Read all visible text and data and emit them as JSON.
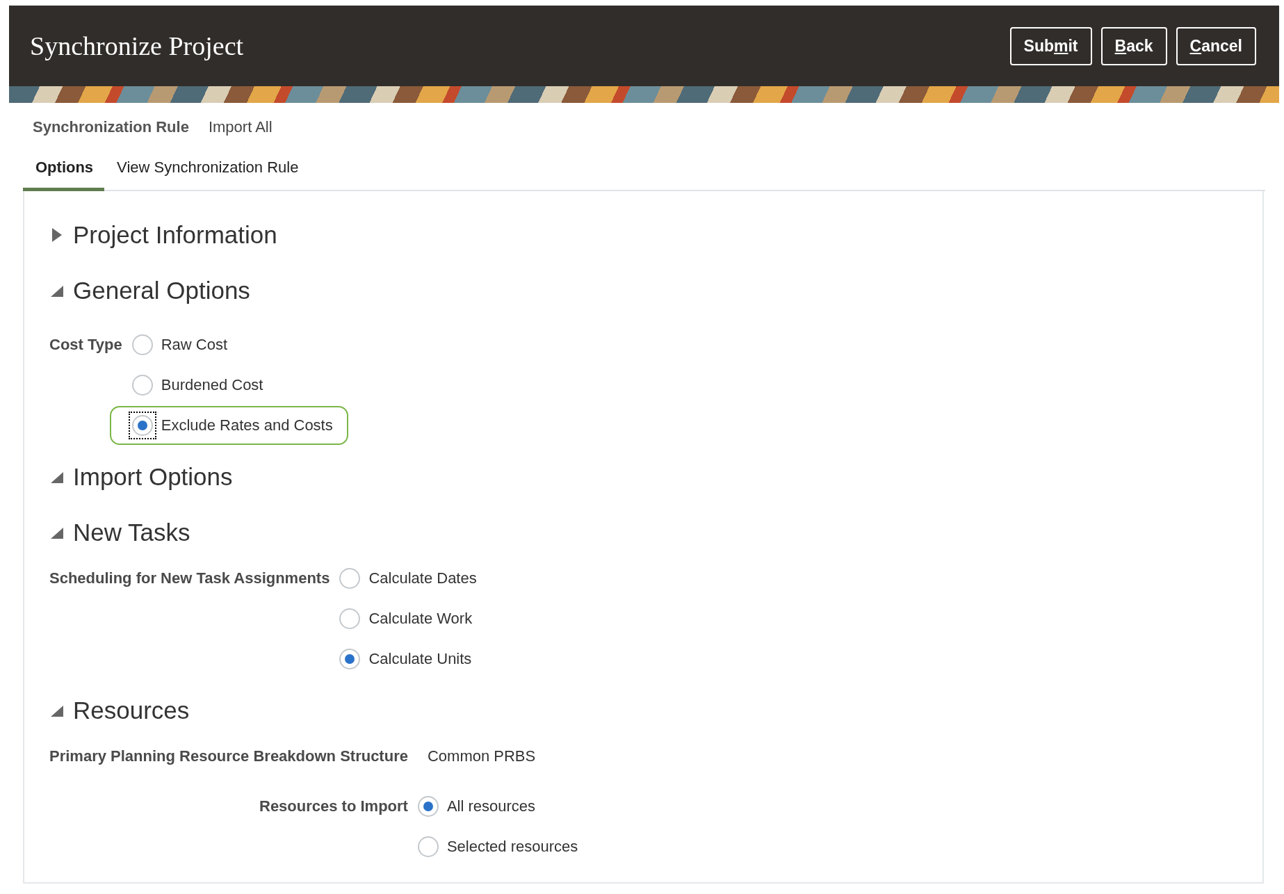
{
  "header": {
    "title": "Synchronize Project",
    "buttons": [
      {
        "before": "Sub",
        "key": "m",
        "after": "it"
      },
      {
        "key": "B",
        "after": "ack"
      },
      {
        "key": "C",
        "after": "ancel"
      }
    ]
  },
  "nav_links": [
    {
      "label": "Synchronization Rule",
      "selected": true
    },
    {
      "label": "Import All",
      "selected": false
    }
  ],
  "tabs": [
    {
      "label": "Options",
      "selected": true
    },
    {
      "label": "View Synchronization Rule",
      "selected": false
    }
  ],
  "sections": [
    {
      "title": "Project Information",
      "expanded": false
    },
    {
      "title": "General Options",
      "expanded": true,
      "fields": [
        {
          "kind": "radio",
          "label": "Cost Type",
          "options": [
            {
              "label": "Raw Cost",
              "selected": false,
              "focused": false,
              "highlighted": false
            },
            {
              "label": "Burdened Cost",
              "selected": false,
              "focused": false,
              "highlighted": false
            },
            {
              "label": "Exclude Rates and Costs",
              "selected": true,
              "focused": true,
              "highlighted": true
            }
          ]
        }
      ]
    },
    {
      "title": "Import Options",
      "expanded": true,
      "children": [
        {
          "title": "New Tasks",
          "expanded": true,
          "fields": [
            {
              "kind": "radio",
              "label": "Scheduling for New Task Assignments",
              "options": [
                {
                  "label": "Calculate Dates",
                  "selected": false,
                  "focused": false,
                  "highlighted": false
                },
                {
                  "label": "Calculate Work",
                  "selected": false,
                  "focused": false,
                  "highlighted": false
                },
                {
                  "label": "Calculate Units",
                  "selected": true,
                  "focused": false,
                  "highlighted": false
                }
              ]
            }
          ]
        },
        {
          "title": "Resources",
          "expanded": true,
          "fields": [
            {
              "kind": "value",
              "label": "Primary Planning Resource Breakdown Structure",
              "value": "Common PRBS"
            },
            {
              "kind": "radio",
              "label": "Resources to Import",
              "options": [
                {
                  "label": "All resources",
                  "selected": true,
                  "focused": false,
                  "highlighted": false
                },
                {
                  "label": "Selected resources",
                  "selected": false,
                  "focused": false,
                  "highlighted": false
                }
              ]
            }
          ]
        }
      ]
    }
  ]
}
